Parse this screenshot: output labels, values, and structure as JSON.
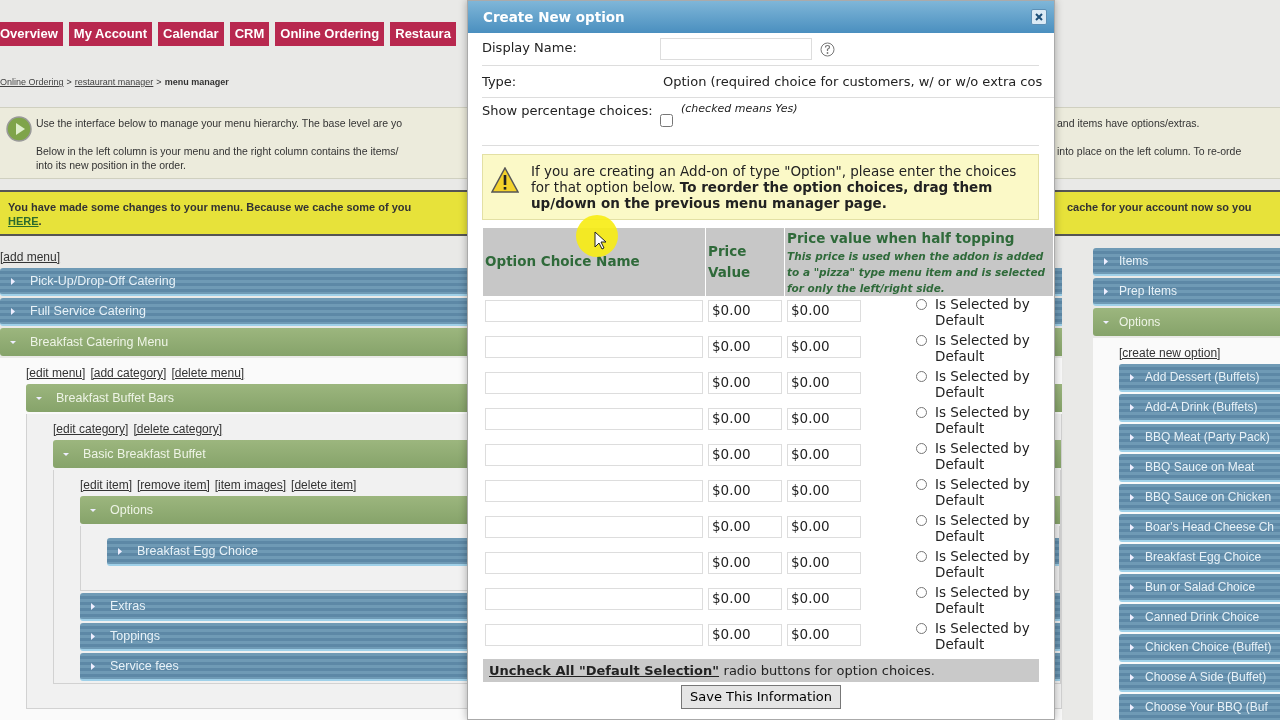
{
  "nav_tabs": [
    {
      "label": "Overview"
    },
    {
      "label": "My Account"
    },
    {
      "label": "Calendar"
    },
    {
      "label": "CRM"
    },
    {
      "label": "Online Ordering"
    },
    {
      "label": "Restaura"
    }
  ],
  "breadcrumb": [
    {
      "label": "Online Ordering",
      "kind": "link"
    },
    {
      "label": ">",
      "kind": "separator"
    },
    {
      "label": "restaurant manager",
      "kind": "link"
    },
    {
      "label": ">",
      "kind": "separator"
    },
    {
      "label": "menu manager",
      "kind": "current"
    }
  ],
  "info": {
    "left_lines": [
      "Use the interface below to manage your menu hierarchy. The base level are yo",
      "Below in the left column is your menu and the right column contains the items/",
      "into its new position in the order."
    ],
    "right_lines": [
      "and items have options/extras.",
      "into place on the left column. To re-orde"
    ]
  },
  "notice": {
    "left_text": "You have made some changes to your menu. Because we cache some of you",
    "link": "HERE",
    "link_suffix": ".",
    "right_text": "cache for your account now so you"
  },
  "left_column": {
    "add_link": "[add menu]",
    "tree": [
      {
        "label": "Pick-Up/Drop-Off Catering",
        "expanded": false
      },
      {
        "label": "Full Service Catering",
        "expanded": false
      },
      {
        "label": "Breakfast Catering Menu",
        "expanded": true,
        "links": [
          "[edit menu]",
          "[add category]",
          "[delete menu]"
        ],
        "children": [
          {
            "label": "Breakfast Buffet Bars",
            "expanded": true,
            "links": [
              "[edit category]",
              "[delete category]"
            ],
            "children": [
              {
                "label": "Basic Breakfast Buffet",
                "expanded": true,
                "links": [
                  "[edit item]",
                  "[remove item]",
                  "[item images]",
                  "[delete item]"
                ],
                "children": [
                  {
                    "label": "Options",
                    "expanded": true,
                    "children": [
                      {
                        "label": "Breakfast Egg Choice",
                        "expanded": false
                      }
                    ]
                  },
                  {
                    "label": "Extras",
                    "expanded": false
                  },
                  {
                    "label": "Toppings",
                    "expanded": false
                  },
                  {
                    "label": "Service fees",
                    "expanded": false
                  }
                ]
              }
            ]
          }
        ]
      }
    ]
  },
  "right_column": {
    "tree": [
      {
        "label": "Items",
        "expanded": false
      },
      {
        "label": "Prep Items",
        "expanded": false
      },
      {
        "label": "Options",
        "expanded": true,
        "links": [
          "[create new option]"
        ],
        "children": [
          {
            "label": "Add Dessert (Buffets)",
            "expanded": false
          },
          {
            "label": "Add-A Drink (Buffets)",
            "expanded": false
          },
          {
            "label": "BBQ Meat (Party Pack)",
            "expanded": false
          },
          {
            "label": "BBQ Sauce on Meat",
            "expanded": false
          },
          {
            "label": "BBQ Sauce on Chicken",
            "expanded": false
          },
          {
            "label": "Boar's Head Cheese Ch",
            "expanded": false
          },
          {
            "label": "Breakfast Egg Choice",
            "expanded": false
          },
          {
            "label": "Bun or Salad Choice",
            "expanded": false
          },
          {
            "label": "Canned Drink Choice",
            "expanded": false
          },
          {
            "label": "Chicken Choice (Buffet)",
            "expanded": false
          },
          {
            "label": "Choose A Side (Buffet)",
            "expanded": false
          },
          {
            "label": "Choose Your BBQ (Buf",
            "expanded": false
          }
        ]
      }
    ]
  },
  "dialog": {
    "title": "Create New option",
    "fields": [
      {
        "kind": "input",
        "label": "Display Name:"
      },
      {
        "kind": "text",
        "label": "Type:",
        "value": "Option (required choice for customers, w/ or w/o extra cos"
      },
      {
        "kind": "checkbox",
        "label": "Show percentage choices:",
        "checked": false,
        "hint": "(checked means Yes)"
      }
    ],
    "warning": "If you are creating an Add-on of type \"Option\", please enter the choices for that option below. **To reorder the option choices, drag them up/down on the previous menu manager page.**",
    "columns": [
      {
        "title": "Option Choice Name"
      },
      {
        "title": "Price Value"
      },
      {
        "title": "Price value when half topping",
        "note": "This price is used when the addon is added to a \"pizza\" type menu item and is selected for only the left/right side."
      }
    ],
    "rows": [
      {
        "price": "$0.00",
        "half_price": "$0.00",
        "default_label": "Is Selected by Default",
        "selected": false
      },
      {
        "price": "$0.00",
        "half_price": "$0.00",
        "default_label": "Is Selected by Default",
        "selected": false
      },
      {
        "price": "$0.00",
        "half_price": "$0.00",
        "default_label": "Is Selected by Default",
        "selected": false
      },
      {
        "price": "$0.00",
        "half_price": "$0.00",
        "default_label": "Is Selected by Default",
        "selected": false
      },
      {
        "price": "$0.00",
        "half_price": "$0.00",
        "default_label": "Is Selected by Default",
        "selected": false
      },
      {
        "price": "$0.00",
        "half_price": "$0.00",
        "default_label": "Is Selected by Default",
        "selected": false
      },
      {
        "price": "$0.00",
        "half_price": "$0.00",
        "default_label": "Is Selected by Default",
        "selected": false
      },
      {
        "price": "$0.00",
        "half_price": "$0.00",
        "default_label": "Is Selected by Default",
        "selected": false
      },
      {
        "price": "$0.00",
        "half_price": "$0.00",
        "default_label": "Is Selected by Default",
        "selected": false
      },
      {
        "price": "$0.00",
        "half_price": "$0.00",
        "default_label": "Is Selected by Default",
        "selected": false
      }
    ],
    "uncheck_link": "Uncheck All \"Default Selection\"",
    "uncheck_text": "radio buttons for option choices.",
    "save_button": "Save This Information"
  }
}
